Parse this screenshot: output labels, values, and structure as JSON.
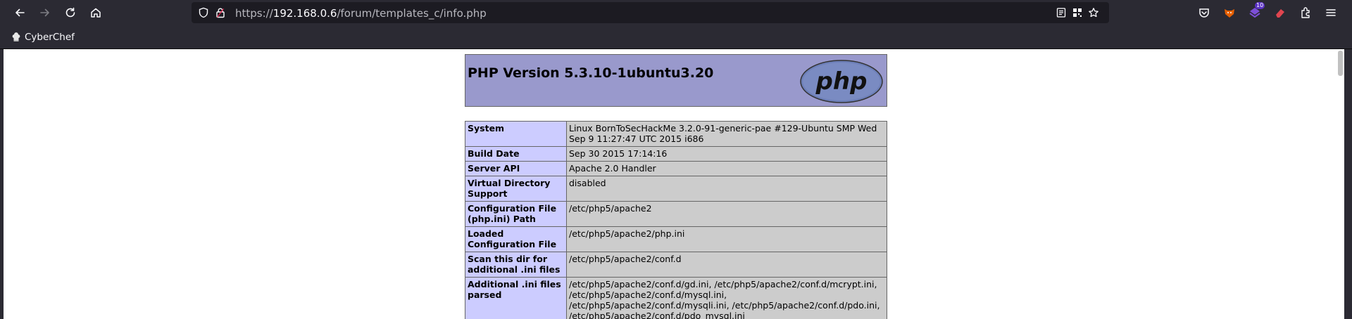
{
  "browser": {
    "url_prefix": "https://",
    "url_host": "192.168.0.6",
    "url_path": "/forum/templates_c/info.php",
    "bookmark_label": "CyberChef",
    "extension_badge": "10",
    "icons": [
      "back-icon",
      "forward-icon",
      "reload-icon",
      "home-icon",
      "shield-icon",
      "lock-icon",
      "reader-icon",
      "qr-icon",
      "star-icon",
      "pocket-icon",
      "fox-extension-icon",
      "badge-extension-icon",
      "eraser-extension-icon",
      "extensions-icon",
      "menu-icon"
    ]
  },
  "phpinfo": {
    "title": "PHP Version 5.3.10-1ubuntu3.20",
    "logo_text": "php",
    "rows": [
      {
        "key": "System",
        "value": "Linux BornToSecHackMe 3.2.0-91-generic-pae #129-Ubuntu SMP Wed Sep 9 11:27:47 UTC 2015 i686"
      },
      {
        "key": "Build Date",
        "value": "Sep 30 2015 17:14:16"
      },
      {
        "key": "Server API",
        "value": "Apache 2.0 Handler"
      },
      {
        "key": "Virtual Directory Support",
        "value": "disabled"
      },
      {
        "key": "Configuration File (php.ini) Path",
        "value": "/etc/php5/apache2"
      },
      {
        "key": "Loaded Configuration File",
        "value": "/etc/php5/apache2/php.ini"
      },
      {
        "key": "Scan this dir for additional .ini files",
        "value": "/etc/php5/apache2/conf.d"
      },
      {
        "key": "Additional .ini files parsed",
        "value": "/etc/php5/apache2/conf.d/gd.ini, /etc/php5/apache2/conf.d/mcrypt.ini, /etc/php5/apache2/conf.d/mysql.ini, /etc/php5/apache2/conf.d/mysqli.ini, /etc/php5/apache2/conf.d/pdo.ini, /etc/php5/apache2/conf.d/pdo_mysql.ini"
      }
    ]
  },
  "colors": {
    "chrome_bg": "#2b2a33",
    "urlbar_bg": "#1c1b22",
    "header_bg": "#9999cc",
    "key_cell_bg": "#ccccff",
    "value_cell_bg": "#cccccc"
  }
}
